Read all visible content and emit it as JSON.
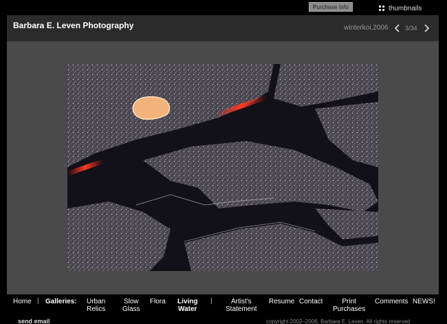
{
  "topbar": {
    "purchase_label": "Purchase Info",
    "thumbnails_label": "thumbnails",
    "thumbnails_icon": "grid-icon"
  },
  "header": {
    "site_title": "Barbara E. Leven Photography",
    "photo_title": "winterkoi,2006",
    "counter": "3/34",
    "prev_icon": "chevron-left-icon",
    "next_icon": "chevron-right-icon"
  },
  "photo": {
    "description_icon": "photo-image"
  },
  "menu": {
    "home": "Home",
    "sep1": "|",
    "galleries": "Galleries:",
    "urban_relics": [
      "Urban",
      "Relics"
    ],
    "slow_glass": [
      "Slow",
      "Glass"
    ],
    "flora": "Flora",
    "living_water": [
      "Living",
      "Water"
    ],
    "sep2": "|",
    "artists_statement": [
      "Artist's",
      "Statement"
    ],
    "resume": "Resume",
    "contact": "Contact",
    "print_purchases": [
      "Print",
      "Purchases"
    ],
    "comments": "Comments",
    "news": "NEWS!"
  },
  "footer": {
    "send_email": "send email",
    "copyright": "copyright 2002–2006, Barbara E. Leven. All rights reserved"
  },
  "colors": {
    "background": "#000000",
    "stage": "#4a4a4a",
    "header": "#2b2b2b",
    "button": "#8a8a8a"
  }
}
